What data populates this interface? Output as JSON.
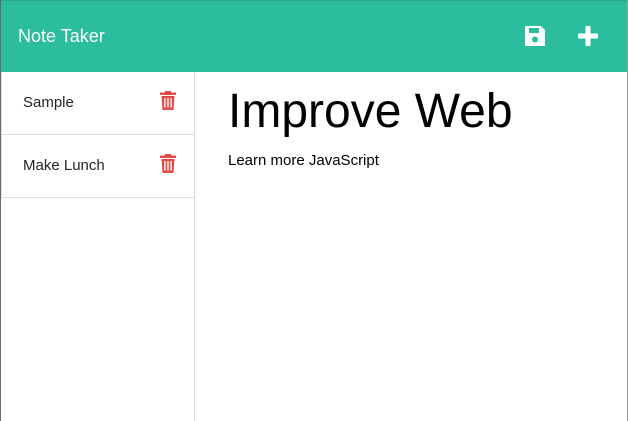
{
  "app": {
    "title": "Note Taker"
  },
  "toolbar": {
    "save_icon": "save-icon",
    "new_icon": "plus-icon"
  },
  "sidebar": {
    "notes": [
      {
        "title": "Sample",
        "delete_icon": "trash-icon"
      },
      {
        "title": "Make Lunch",
        "delete_icon": "trash-icon"
      }
    ]
  },
  "active_note": {
    "title": "Improve Web",
    "text": "Learn more JavaScript"
  },
  "colors": {
    "navbar": "#2bbd9e",
    "delete": "#e04b46",
    "icon": "#ffffff"
  }
}
